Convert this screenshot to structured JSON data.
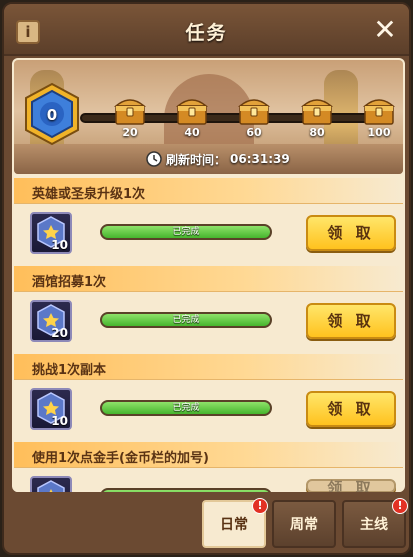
{
  "header": {
    "info_label": "i",
    "title": "任务",
    "close_label": "✕"
  },
  "progress": {
    "level": "0",
    "fill_fraction": 0.0,
    "chests": [
      "20",
      "40",
      "60",
      "80",
      "100"
    ]
  },
  "refresh": {
    "label": "刷新时间：",
    "time": "06:31:39"
  },
  "tasks": [
    {
      "name": "英雄或圣泉升级1次",
      "reward_count": "10",
      "status": "已完成",
      "progress_fraction": 1.0,
      "button": "领 取"
    },
    {
      "name": "酒馆招募1次",
      "reward_count": "20",
      "status": "已完成",
      "progress_fraction": 1.0,
      "button": "领 取"
    },
    {
      "name": "挑战1次副本",
      "reward_count": "10",
      "status": "已完成",
      "progress_fraction": 1.0,
      "button": "领 取"
    },
    {
      "name": "使用1次点金手(金币栏的加号)",
      "reward_count": "",
      "status": "",
      "progress_fraction": 1.0,
      "button": "领 取"
    }
  ],
  "tabs": [
    {
      "label": "日常",
      "badge": "!",
      "active": true
    },
    {
      "label": "周常",
      "badge": "",
      "active": false
    },
    {
      "label": "主线",
      "badge": "!",
      "active": false
    }
  ],
  "colors": {
    "accent": "#ffc21e",
    "progress_green": "#46b52e",
    "badge_red": "#e23124"
  }
}
